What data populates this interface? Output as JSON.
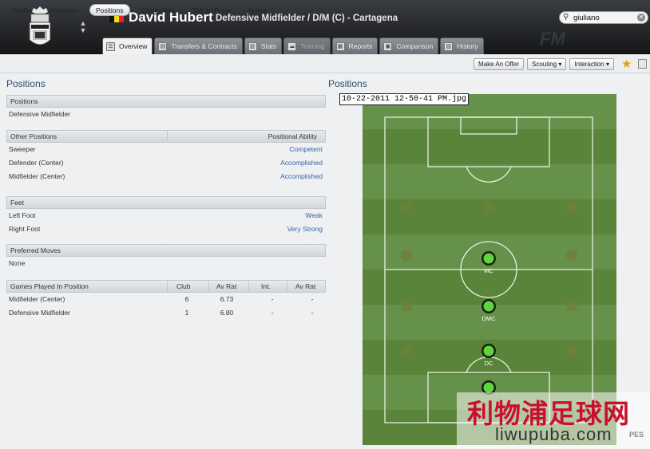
{
  "header": {
    "player_name": "David Hubert",
    "role": "Defensive Midfielder / D/M (C) - Cartagena",
    "search_value": "giuliano",
    "flag_colors": [
      "#111111",
      "#f5d90a",
      "#e3222b"
    ],
    "watermark": "FM",
    "tabs": [
      {
        "label": "Overview",
        "icon": "overview-icon",
        "state": "active"
      },
      {
        "label": "Transfers & Contracts",
        "icon": "contract-icon",
        "state": "normal"
      },
      {
        "label": "Stats",
        "icon": "stats-icon",
        "state": "normal"
      },
      {
        "label": "Training",
        "icon": "training-icon",
        "state": "disabled"
      },
      {
        "label": "Reports",
        "icon": "reports-icon",
        "state": "normal"
      },
      {
        "label": "Comparison",
        "icon": "comparison-icon",
        "state": "normal"
      },
      {
        "label": "History",
        "icon": "history-icon",
        "state": "normal"
      }
    ]
  },
  "subnav": {
    "items": [
      "Profile",
      "Attributes",
      "Positions",
      "Information",
      "Talk to Press",
      "Notes"
    ],
    "active": "Positions",
    "actions": [
      "Make An Offer",
      "Scouting",
      "Interaction"
    ]
  },
  "left": {
    "title": "Positions",
    "positions_header": "Positions",
    "position": "Defensive Midfielder",
    "other_header": "Other Positions",
    "ability_header": "Positional Ability",
    "other_positions": [
      {
        "name": "Sweeper",
        "ability": "Competent"
      },
      {
        "name": "Defender (Center)",
        "ability": "Accomplished"
      },
      {
        "name": "Midfielder (Center)",
        "ability": "Accomplished"
      }
    ],
    "feet_header": "Feet",
    "feet": [
      {
        "name": "Left Foot",
        "value": "Weak"
      },
      {
        "name": "Right Foot",
        "value": "Very Strong"
      }
    ],
    "moves_header": "Preferred Moves",
    "moves": "None",
    "games_header": [
      "Games Played In Position",
      "Club",
      "Av Rat",
      "Int.",
      "Av Rat"
    ],
    "games": [
      [
        "Midfielder (Center)",
        "6",
        "6.73",
        "-",
        "-"
      ],
      [
        "Defensive Midfielder",
        "1",
        "6.80",
        "-",
        "-"
      ]
    ]
  },
  "right": {
    "title": "Positions",
    "image_tag": "10-22-2011 12-50-41 PM.jpg",
    "pitch_labels": {
      "mc": "MC",
      "dmc": "DMC",
      "dc": "DC"
    },
    "colors": {
      "pitch": "#5f8a3f",
      "active": "#5ed53a",
      "inactive": "#6f7f3a"
    }
  },
  "watermark": {
    "cn": "利物浦足球网",
    "url": "liwupuba.com",
    "pes": "PES"
  }
}
